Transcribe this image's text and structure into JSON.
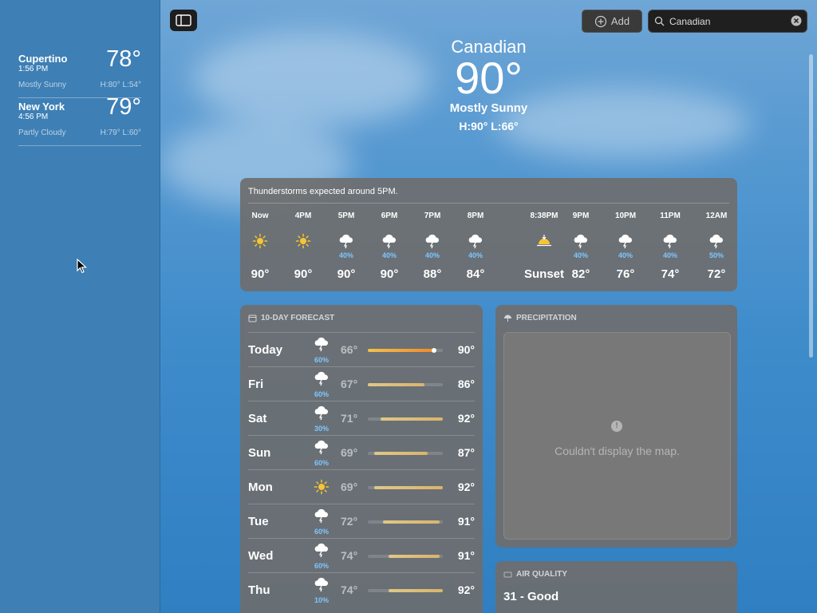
{
  "sidebar": {
    "cities": [
      {
        "name": "Cupertino",
        "time": "1:56 PM",
        "temp": "78°",
        "condition": "Mostly Sunny",
        "hilo": "H:80°  L:54°"
      },
      {
        "name": "New York",
        "time": "4:56 PM",
        "temp": "79°",
        "condition": "Partly Cloudy",
        "hilo": "H:79°  L:60°"
      }
    ]
  },
  "toolbar": {
    "add_label": "Add",
    "search_value": "Canadian"
  },
  "header": {
    "city": "Canadian",
    "temp": "90°",
    "condition": "Mostly Sunny",
    "hilo": "H:90°  L:66°"
  },
  "hourly": {
    "summary": "Thunderstorms expected around 5PM.",
    "items": [
      {
        "label": "Now",
        "icon": "sun-icon",
        "pct": "",
        "temp": "90°"
      },
      {
        "label": "4PM",
        "icon": "sun-icon",
        "pct": "",
        "temp": "90°"
      },
      {
        "label": "5PM",
        "icon": "thunderstorm-icon",
        "pct": "40%",
        "temp": "90°"
      },
      {
        "label": "6PM",
        "icon": "thunderstorm-icon",
        "pct": "40%",
        "temp": "90°"
      },
      {
        "label": "7PM",
        "icon": "thunderstorm-icon",
        "pct": "40%",
        "temp": "88°"
      },
      {
        "label": "8PM",
        "icon": "thunderstorm-icon",
        "pct": "40%",
        "temp": "84°"
      },
      {
        "label": "8:38PM",
        "icon": "sunset-icon",
        "pct": "",
        "temp": "Sunset"
      },
      {
        "label": "9PM",
        "icon": "thunderstorm-icon",
        "pct": "40%",
        "temp": "82°"
      },
      {
        "label": "10PM",
        "icon": "thunderstorm-icon",
        "pct": "40%",
        "temp": "76°"
      },
      {
        "label": "11PM",
        "icon": "thunderstorm-icon",
        "pct": "40%",
        "temp": "74°"
      },
      {
        "label": "12AM",
        "icon": "thunderstorm-icon",
        "pct": "50%",
        "temp": "72°"
      }
    ]
  },
  "forecast": {
    "title": "10-DAY FORECAST",
    "days": [
      {
        "day": "Today",
        "icon": "thunderstorm-icon",
        "pct": "60%",
        "lo": "66°",
        "hi": "90°",
        "range_start": 0.0,
        "range_end": 0.88
      },
      {
        "day": "Fri",
        "icon": "thunderstorm-icon",
        "pct": "60%",
        "lo": "67°",
        "hi": "86°",
        "range_start": 0.0,
        "range_end": 0.76
      },
      {
        "day": "Sat",
        "icon": "thunderstorm-icon",
        "pct": "30%",
        "lo": "71°",
        "hi": "92°",
        "range_start": 0.17,
        "range_end": 1.0
      },
      {
        "day": "Sun",
        "icon": "thunderstorm-icon",
        "pct": "60%",
        "lo": "69°",
        "hi": "87°",
        "range_start": 0.08,
        "range_end": 0.8
      },
      {
        "day": "Mon",
        "icon": "sun-icon",
        "pct": "",
        "lo": "69°",
        "hi": "92°",
        "range_start": 0.08,
        "range_end": 1.0
      },
      {
        "day": "Tue",
        "icon": "thunderstorm-icon",
        "pct": "60%",
        "lo": "72°",
        "hi": "91°",
        "range_start": 0.2,
        "range_end": 0.96
      },
      {
        "day": "Wed",
        "icon": "thunderstorm-icon",
        "pct": "60%",
        "lo": "74°",
        "hi": "91°",
        "range_start": 0.28,
        "range_end": 0.96
      },
      {
        "day": "Thu",
        "icon": "thunderstorm-icon",
        "pct": "10%",
        "lo": "74°",
        "hi": "92°",
        "range_start": 0.28,
        "range_end": 1.0
      }
    ]
  },
  "precipitation": {
    "title": "PRECIPITATION",
    "message": "Couldn't display the map."
  },
  "air_quality": {
    "title": "AIR QUALITY",
    "value": "31 - Good"
  },
  "colors": {
    "sidebar_bg": "#3e7fb5",
    "panel_bg": "#6e6e6e",
    "precip_blue": "#7fc6ff",
    "sun_yellow": "#f7c531"
  }
}
